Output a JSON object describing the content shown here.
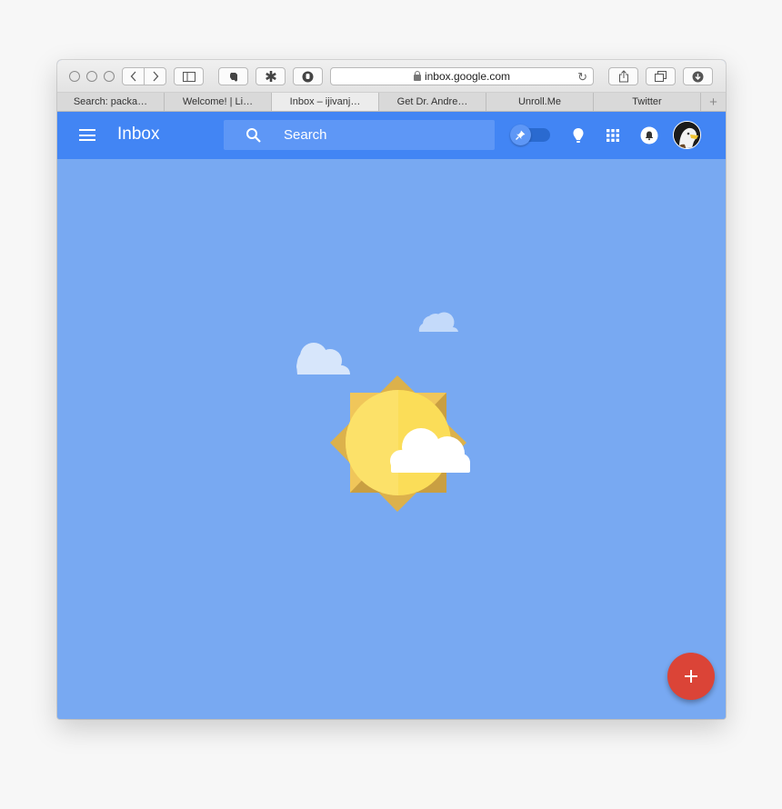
{
  "browser": {
    "url": "inbox.google.com",
    "tabs": [
      {
        "label": "Search: packa…",
        "active": false
      },
      {
        "label": "Welcome! | Li…",
        "active": false
      },
      {
        "label": "Inbox – ijivanj…",
        "active": true
      },
      {
        "label": "Get Dr. Andre…",
        "active": false
      },
      {
        "label": "Unroll.Me",
        "active": false
      },
      {
        "label": "Twitter",
        "active": false
      }
    ],
    "new_tab_label": "+",
    "reload_glyph": "↻"
  },
  "appbar": {
    "title": "Inbox",
    "search_placeholder": "Search",
    "pin_toggle_on": false,
    "icons": [
      "menu-icon",
      "search-icon",
      "pin-icon",
      "reminder-icon",
      "apps-icon",
      "notification-bell-icon",
      "avatar"
    ]
  },
  "fab": {
    "label": "+"
  },
  "colors": {
    "appbar": "#4285f4",
    "background": "#78a9f2",
    "fab": "#db4437"
  }
}
